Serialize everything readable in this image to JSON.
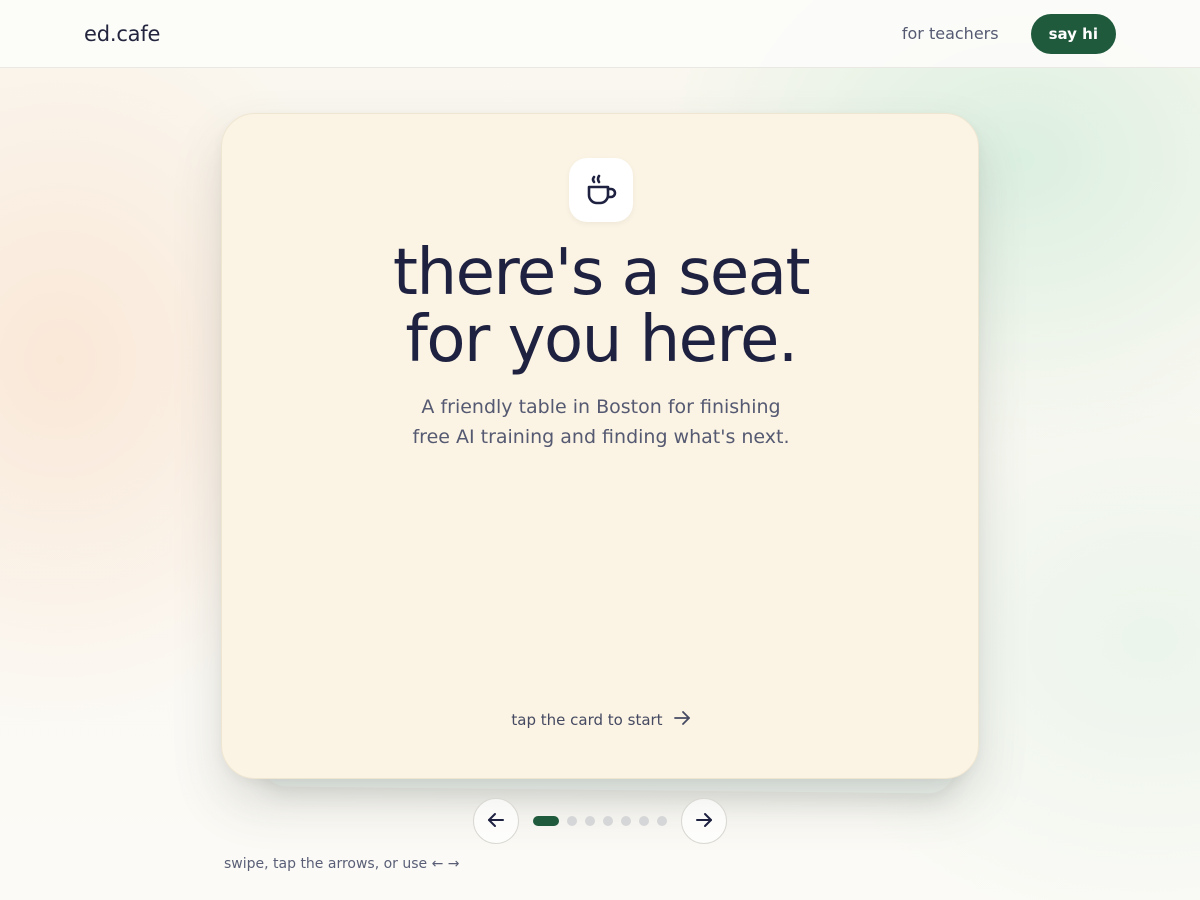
{
  "header": {
    "logo": "ed.cafe",
    "nav_link": "for teachers",
    "cta_label": "say hi"
  },
  "card": {
    "icon": "coffee-cup-icon",
    "headline_line1": "there's a seat",
    "headline_line2": "for you here.",
    "subtitle_line1": "A friendly table in Boston for finishing",
    "subtitle_line2": "free AI training and finding what's next.",
    "hint": "tap the card to start"
  },
  "carousel": {
    "total_slides": 7,
    "active_index": 0,
    "prev_icon": "arrow-left-icon",
    "next_icon": "arrow-right-icon"
  },
  "footer": {
    "hint": "swipe, tap the arrows, or use ← →"
  },
  "colors": {
    "accent": "#1f5a3c",
    "card_bg": "#fbf3e3",
    "text_dark": "#1e2140",
    "text_muted": "#555a72"
  }
}
